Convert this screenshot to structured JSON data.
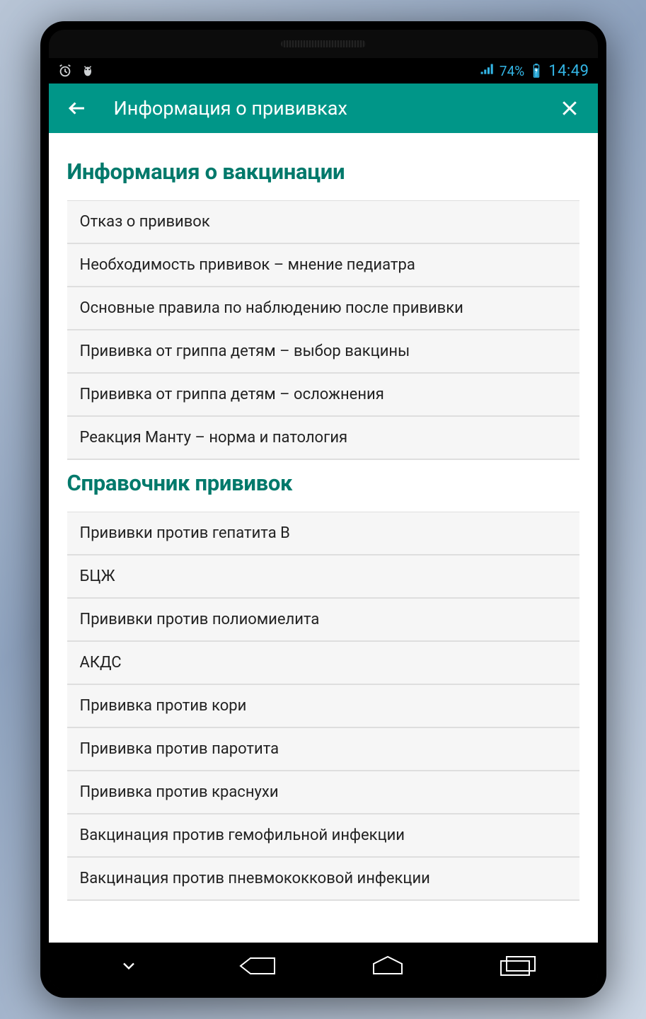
{
  "status_bar": {
    "battery_pct": "74%",
    "time": "14:49"
  },
  "header": {
    "title": "Информация о прививках"
  },
  "sections": [
    {
      "title": "Информация о вакцинации",
      "items": [
        "Отказ о прививок",
        "Необходимость прививок – мнение педиатра",
        "Основные правила по наблюдению после прививки",
        "Прививка от гриппа детям – выбор вакцины",
        "Прививка от гриппа детям – осложнения",
        "Реакция Манту – норма и патология"
      ]
    },
    {
      "title": "Справочник прививок",
      "items": [
        "Прививки против гепатита B",
        "БЦЖ",
        "Прививки против полиомиелита",
        "АКДС",
        "Прививка против кори",
        "Прививка против паротита",
        "Прививка против краснухи",
        "Вакцинация против гемофильной инфекции",
        "Вакцинация против пневмококковой инфекции"
      ]
    }
  ]
}
